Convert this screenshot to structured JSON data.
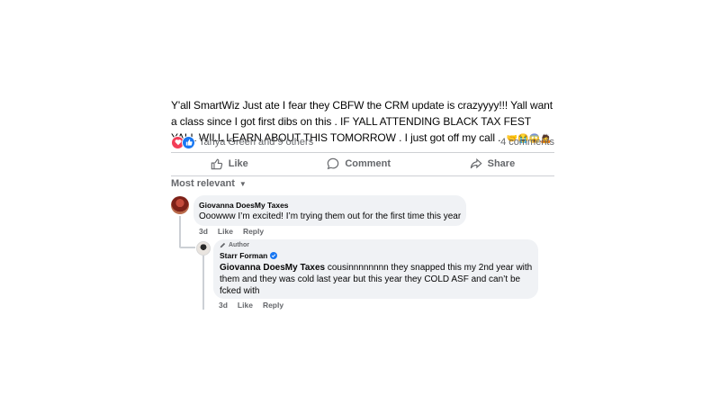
{
  "post": {
    "text": "Y'all SmartWiz Just ate I fear they CBFW the CRM update is crazyyyy!!! Yall want a class since I got first dibs on this . IF YALL ATTENDING BLACK TAX FEST YALL WILL LEARN ABOUT THIS TOMORROW . I just got off my call .",
    "emojis": "🤝😭😱🙇"
  },
  "reactions": {
    "icons": [
      "love-reaction",
      "like-reaction"
    ],
    "names": "Tanya Green and 9 others",
    "comment_count": "4 comments"
  },
  "actions": {
    "like": "Like",
    "comment": "Comment",
    "share": "Share"
  },
  "sort": {
    "label": "Most relevant"
  },
  "comments": [
    {
      "author": "Giovanna DoesMy Taxes",
      "text": "Ooowww I’m excited! I’m trying them out for the first time this year",
      "time": "3d",
      "like": "Like",
      "reply": "Reply"
    }
  ],
  "reply": {
    "badge": "Author",
    "author": "Starr Forman",
    "mention": "Giovanna DoesMy Taxes",
    "text": "cousinnnnnnnn they snapped this my 2nd year with them and they was cold last year but this year they COLD ASF and can’t be fcked with",
    "time": "3d",
    "like": "Like",
    "reply": "Reply"
  },
  "colors": {
    "accent": "#1877f2",
    "love": "#f33e58",
    "muted": "#65676b",
    "bubble": "#f0f2f5"
  }
}
